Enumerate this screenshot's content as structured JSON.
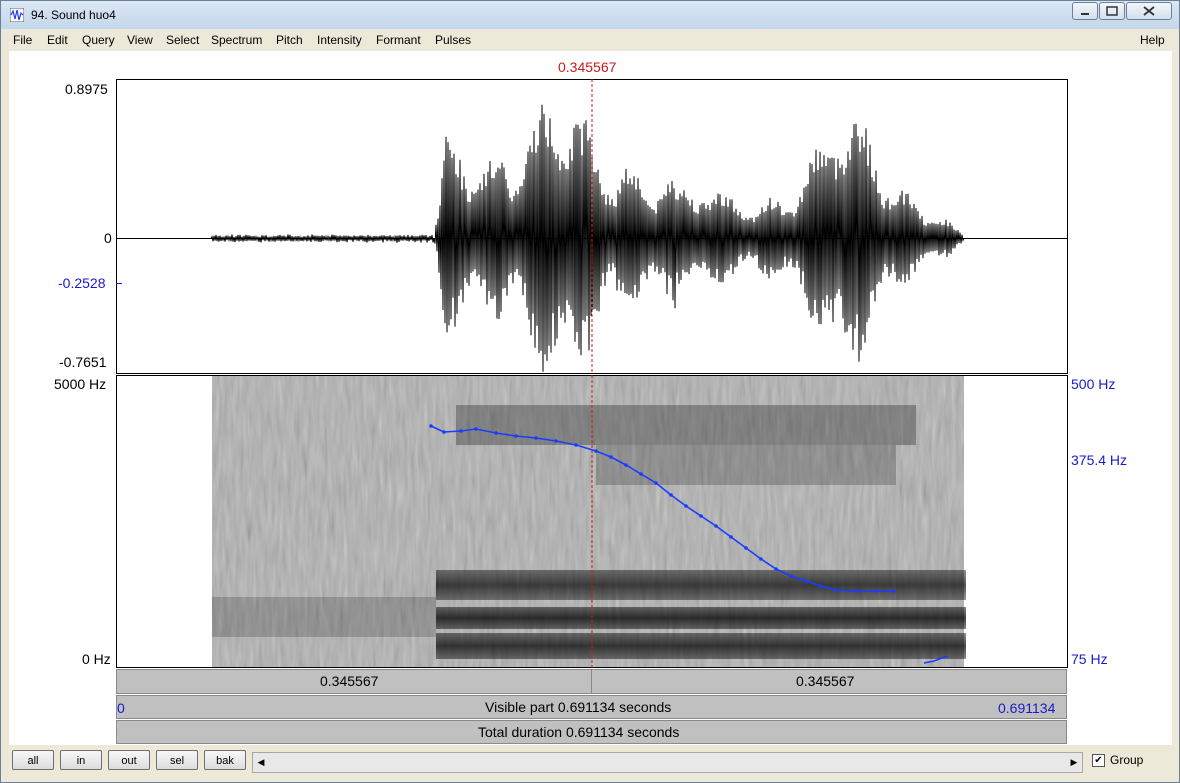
{
  "window": {
    "title": "94. Sound huo4"
  },
  "menu": [
    "File",
    "Edit",
    "Query",
    "View",
    "Select",
    "Spectrum",
    "Pitch",
    "Intensity",
    "Formant",
    "Pulses"
  ],
  "help": "Help",
  "cursor": {
    "time_label": "0.345567",
    "fraction": 0.5
  },
  "waveform": {
    "y_max": "0.8975",
    "y_zero": "0",
    "y_sel": "-0.2528",
    "y_min": "-0.7651"
  },
  "spectrogram": {
    "f_max": "5000 Hz",
    "f_min": "0 Hz",
    "pitch_top": "500 Hz",
    "pitch_mid": "375.4 Hz",
    "pitch_bottom": "75 Hz"
  },
  "timebar": {
    "left": "0.345567",
    "right": "0.345567",
    "start": "0",
    "end": "0.691134",
    "visible": "Visible part 0.691134 seconds",
    "total": "Total duration 0.691134 seconds"
  },
  "buttons": {
    "all": "all",
    "in": "in",
    "out": "out",
    "sel": "sel",
    "bak": "bak"
  },
  "group": {
    "label": "Group",
    "checked": true
  },
  "colors": {
    "pitch": "#1a3cff",
    "cursor": "#cc1a1a",
    "axis_blue": "#1a1acc"
  }
}
